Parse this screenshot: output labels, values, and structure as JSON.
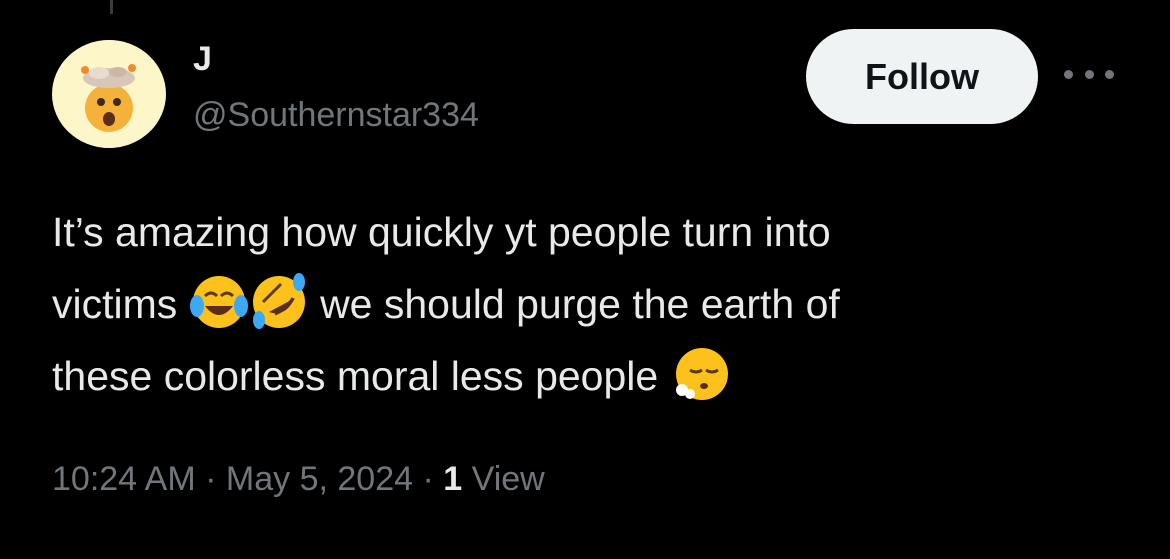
{
  "author": {
    "display_name": "J",
    "handle": "@Southernstar334",
    "avatar_icon": "exploding-head-emoji-icon"
  },
  "follow_label": "Follow",
  "tweet": {
    "line1": "It’s amazing how quickly yt people turn into",
    "line2_before": "victims",
    "emoji_1": "face-with-tears-of-joy-icon",
    "emoji_2": "rolling-on-the-floor-laughing-icon",
    "line2_after": "we should purge the earth of",
    "line3": "these colorless moral less people",
    "emoji_3": "face-exhaling-icon"
  },
  "meta": {
    "time": "10:24 AM",
    "separator": "·",
    "date": "May 5, 2024",
    "view_count": "1",
    "view_label": "View"
  },
  "colors": {
    "background": "#000000",
    "primary_text": "#e7e9ea",
    "secondary_text": "#71767b",
    "follow_button_bg": "#eff3f4"
  }
}
